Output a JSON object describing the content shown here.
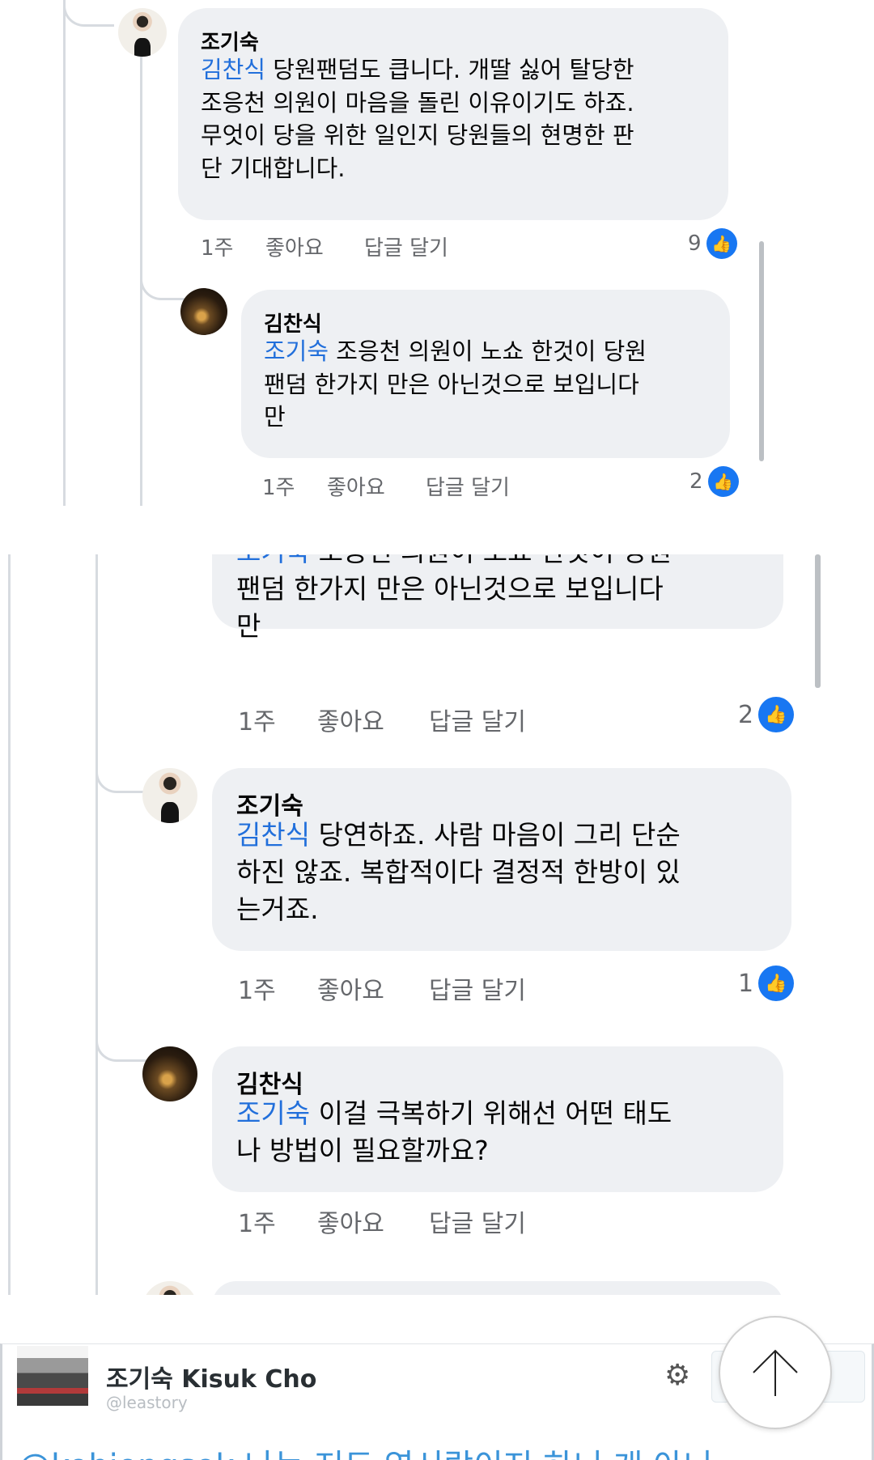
{
  "panel1": {
    "c1": {
      "author": "조기숙",
      "mention": "김찬식",
      "lines": [
        "당원팬덤도 큽니다. 개딸 싫어 탈당한",
        "조응천 의원이 마음을 돌린 이유이기도 하죠.",
        "무엇이 당을 위한 일인지 당원들의 현명한 판",
        "단 기대합니다."
      ],
      "time": "1주",
      "like": "좋아요",
      "reply": "답글 달기",
      "count": "9"
    },
    "c2": {
      "author": "김찬식",
      "mention": "조기숙",
      "lines": [
        "조응천 의원이 노쇼 한것이 당원",
        "팬덤 한가지 만은 아닌것으로 보입니다",
        "만"
      ],
      "time": "1주",
      "like": "좋아요",
      "reply": "답글 달기",
      "count": "2"
    }
  },
  "panel2": {
    "top": {
      "mention": "조기숙",
      "lines": [
        "조응천 의원이 노쇼 한것이 당원",
        "팬덤 한가지 만은 아닌것으로 보입니다",
        "만"
      ],
      "time": "1주",
      "like": "좋아요",
      "reply": "답글 달기",
      "count": "2"
    },
    "c3": {
      "author": "조기숙",
      "mention": "김찬식",
      "lines": [
        "당연하죠. 사람 마음이 그리 단순",
        "하진 않죠. 복합적이다 결정적 한방이 있",
        "는거죠."
      ],
      "time": "1주",
      "like": "좋아요",
      "reply": "답글 달기",
      "count": "1"
    },
    "c4": {
      "author": "김찬식",
      "mention": "조기숙",
      "lines": [
        "이걸 극복하기 위해선 어떤 태도",
        "나 방법이 필요할까요?"
      ],
      "time": "1주",
      "like": "좋아요",
      "reply": "답글 달기"
    }
  },
  "panel3": {
    "name": "조기숙 Kisuk Cho",
    "handle": "@leastory",
    "tweet": "@kohjongsok 나는 저도 역시랍이지 하니 개 아니"
  },
  "icons": {
    "like": "like-thumb-icon",
    "gear": "gear-icon",
    "scroll_top": "arrow-up-icon"
  },
  "colors": {
    "mention": "#216fdb",
    "bubble": "#eef0f3",
    "like": "#1877f2"
  }
}
